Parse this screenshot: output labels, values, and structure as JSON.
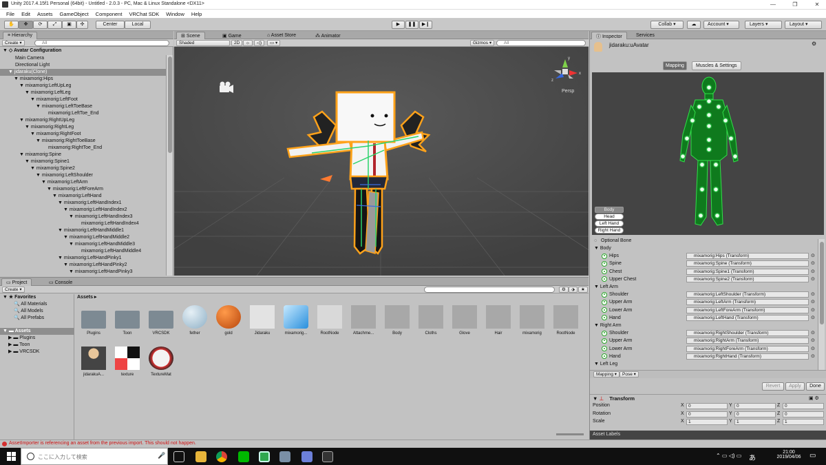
{
  "window": {
    "title": "Unity 2017.4.15f1 Personal (64bit) - Untitled - 2.0.3 - PC, Mac & Linux Standalone <DX11>"
  },
  "menu": [
    "File",
    "Edit",
    "Assets",
    "GameObject",
    "Component",
    "VRChat SDK",
    "Window",
    "Help"
  ],
  "toolbar": {
    "center": "Center",
    "local": "Local",
    "collab": "Collab ▾",
    "account": "Account",
    "layers": "Layers",
    "layout": "Layout"
  },
  "hierarchy": {
    "tab": "Hierarchy",
    "create": "Create",
    "search_placeholder": "All",
    "scene": "Avatar Configuration",
    "rows": [
      {
        "label": "Main Camera",
        "indent": 0,
        "arrow": false
      },
      {
        "label": "Directional Light",
        "indent": 0,
        "arrow": false
      },
      {
        "label": "jidaraku(Clone)",
        "indent": 0,
        "arrow": true,
        "selected": true
      },
      {
        "label": "mixamorig:Hips",
        "indent": 1,
        "arrow": true
      },
      {
        "label": "mixamorig:LeftUpLeg",
        "indent": 2,
        "arrow": true
      },
      {
        "label": "mixamorig:LeftLeg",
        "indent": 3,
        "arrow": true
      },
      {
        "label": "mixamorig:LeftFoot",
        "indent": 4,
        "arrow": true
      },
      {
        "label": "mixamorig:LeftToeBase",
        "indent": 5,
        "arrow": true
      },
      {
        "label": "mixamorig:LeftToe_End",
        "indent": 6,
        "arrow": false
      },
      {
        "label": "mixamorig:RightUpLeg",
        "indent": 2,
        "arrow": true
      },
      {
        "label": "mixamorig:RightLeg",
        "indent": 3,
        "arrow": true
      },
      {
        "label": "mixamorig:RightFoot",
        "indent": 4,
        "arrow": true
      },
      {
        "label": "mixamorig:RightToeBase",
        "indent": 5,
        "arrow": true
      },
      {
        "label": "mixamorig:RightToe_End",
        "indent": 6,
        "arrow": false
      },
      {
        "label": "mixamorig:Spine",
        "indent": 2,
        "arrow": true
      },
      {
        "label": "mixamorig:Spine1",
        "indent": 3,
        "arrow": true
      },
      {
        "label": "mixamorig:Spine2",
        "indent": 4,
        "arrow": true
      },
      {
        "label": "mixamorig:LeftShoulder",
        "indent": 5,
        "arrow": true
      },
      {
        "label": "mixamorig:LeftArm",
        "indent": 6,
        "arrow": true
      },
      {
        "label": "mixamorig:LeftForeArm",
        "indent": 7,
        "arrow": true
      },
      {
        "label": "mixamorig:LeftHand",
        "indent": 8,
        "arrow": true
      },
      {
        "label": "mixamorig:LeftHandIndex1",
        "indent": 9,
        "arrow": true
      },
      {
        "label": "mixamorig:LeftHandIndex2",
        "indent": 10,
        "arrow": true
      },
      {
        "label": "mixamorig:LeftHandIndex3",
        "indent": 11,
        "arrow": true
      },
      {
        "label": "mixamorig:LeftHandIndex4",
        "indent": 12,
        "arrow": false
      },
      {
        "label": "mixamorig:LeftHandMiddle1",
        "indent": 9,
        "arrow": true
      },
      {
        "label": "mixamorig:LeftHandMiddle2",
        "indent": 10,
        "arrow": true
      },
      {
        "label": "mixamorig:LeftHandMiddle3",
        "indent": 11,
        "arrow": true
      },
      {
        "label": "mixamorig:LeftHandMiddle4",
        "indent": 12,
        "arrow": false
      },
      {
        "label": "mixamorig:LeftHandPinky1",
        "indent": 9,
        "arrow": true
      },
      {
        "label": "mixamorig:LeftHandPinky2",
        "indent": 10,
        "arrow": true
      },
      {
        "label": "mixamorig:LeftHandPinky3",
        "indent": 11,
        "arrow": true
      }
    ]
  },
  "scene": {
    "tabs": [
      "Scene",
      "Game",
      "Asset Store",
      "Animator"
    ],
    "shading": "Shaded",
    "mode2d": "2D",
    "gizmos": "Gizmos ▾",
    "search_placeholder": "All",
    "persp": "Persp",
    "gizmo_axes": {
      "y": "y",
      "x": "x",
      "z": "z"
    }
  },
  "project": {
    "tabs": [
      "Project",
      "Console"
    ],
    "create": "Create",
    "favorites": "Favorites",
    "fav_items": [
      "All Materials",
      "All Models",
      "All Prefabs"
    ],
    "assets_root": "Assets",
    "folders": [
      "Plugins",
      "Toon",
      "VRCSDK"
    ],
    "breadcrumb": "Assets",
    "assets_row1": [
      "Plugins",
      "Toon",
      "VRCSDK",
      "fether",
      "gold",
      "Jidaraku",
      "mixamorig...",
      "RootNode",
      "Attachme...",
      "Body",
      "Cloths",
      "Glove",
      "Hair",
      "mixamorig",
      "RootNode"
    ],
    "assets_row2": [
      "jidarakuA...",
      "texture",
      "TextureMat"
    ]
  },
  "inspector": {
    "tabs": [
      "Inspector",
      "Services"
    ],
    "object_name": "jidaraku:uAvatar",
    "mode_tabs": [
      "Mapping",
      "Muscles & Settings"
    ],
    "body_buttons": [
      "Body",
      "Head",
      "Left Hand",
      "Right Hand"
    ],
    "optional_bone": "Optional Bone",
    "groups": [
      {
        "name": "Body",
        "bones": [
          {
            "label": "Hips",
            "value": "mixamorig:Hips (Transform)"
          },
          {
            "label": "Spine",
            "value": "mixamorig:Spine (Transform)"
          },
          {
            "label": "Chest",
            "value": "mixamorig:Spine1 (Transform)"
          },
          {
            "label": "Upper Chest",
            "value": "mixamorig:Spine2 (Transform)"
          }
        ]
      },
      {
        "name": "Left Arm",
        "bones": [
          {
            "label": "Shoulder",
            "value": "mixamorig:LeftShoulder (Transform)"
          },
          {
            "label": "Upper Arm",
            "value": "mixamorig:LeftArm (Transform)"
          },
          {
            "label": "Lower Arm",
            "value": "mixamorig:LeftForeArm (Transform)"
          },
          {
            "label": "Hand",
            "value": "mixamorig:LeftHand (Transform)"
          }
        ]
      },
      {
        "name": "Right Arm",
        "bones": [
          {
            "label": "Shoulder",
            "value": "mixamorig:RightShoulder (Transform)"
          },
          {
            "label": "Upper Arm",
            "value": "mixamorig:RightArm (Transform)"
          },
          {
            "label": "Lower Arm",
            "value": "mixamorig:RightForeArm (Transform)"
          },
          {
            "label": "Hand",
            "value": "mixamorig:RightHand (Transform)"
          }
        ]
      },
      {
        "name": "Left Leg",
        "bones": []
      }
    ],
    "footer_dropdowns": [
      "Mapping ▾",
      "Pose ▾"
    ],
    "revert": "Revert",
    "apply": "Apply",
    "done": "Done",
    "transform": {
      "title": "Transform",
      "rows": [
        {
          "label": "Position",
          "x": "0",
          "y": "0",
          "z": "0"
        },
        {
          "label": "Rotation",
          "x": "0",
          "y": "0",
          "z": "0"
        },
        {
          "label": "Scale",
          "x": "1",
          "y": "1",
          "z": "1"
        }
      ]
    },
    "asset_labels": "Asset Labels"
  },
  "status": {
    "message": "AssetImporter is referencing an asset from the previous import. This should not happen."
  },
  "taskbar": {
    "search_placeholder": "ここに入力して検索",
    "time": "21:00",
    "date": "2019/04/06",
    "ime": "あ"
  },
  "colors": {
    "selection": "#8e8e8e",
    "bone_green": "#2aa52a",
    "outline_orange": "#ffa21a",
    "error_red": "#d32f2f"
  }
}
